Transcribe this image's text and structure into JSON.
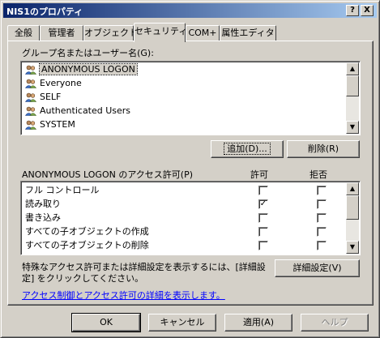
{
  "window": {
    "title": "NIS1のプロパティ",
    "help_glyph": "?",
    "close_glyph": "X"
  },
  "tabs": [
    {
      "label": "全般"
    },
    {
      "label": "管理者"
    },
    {
      "label": "オブジェクト"
    },
    {
      "label": "セキュリティ",
      "active": true
    },
    {
      "label": "COM+"
    },
    {
      "label": "属性エディタ"
    }
  ],
  "users_section": {
    "label": "グループ名またはユーザー名(G):",
    "items": [
      {
        "name": "ANONYMOUS LOGON",
        "selected": true
      },
      {
        "name": "Everyone"
      },
      {
        "name": "SELF"
      },
      {
        "name": "Authenticated Users"
      },
      {
        "name": "SYSTEM"
      }
    ],
    "add_button": "追加(D)...",
    "remove_button": "削除(R)"
  },
  "permissions_section": {
    "label": "ANONYMOUS LOGON のアクセス許可(P)",
    "allow_header": "許可",
    "deny_header": "拒否",
    "rows": [
      {
        "name": "フル コントロール",
        "allow": false,
        "deny": false
      },
      {
        "name": "読み取り",
        "allow": true,
        "deny": false
      },
      {
        "name": "書き込み",
        "allow": false,
        "deny": false
      },
      {
        "name": "すべての子オブジェクトの作成",
        "allow": false,
        "deny": false
      },
      {
        "name": "すべての子オブジェクトの削除",
        "allow": false,
        "deny": false
      }
    ],
    "check_glyph": "✓"
  },
  "advanced": {
    "text_line1": "特殊なアクセス許可または詳細設定を表示するには、[詳細設",
    "text_line2": "定] をクリックしてください。",
    "button": "詳細設定(V)"
  },
  "link": "アクセス制御とアクセス許可の詳細を表示します。",
  "footer": {
    "ok": "OK",
    "cancel": "キャンセル",
    "apply": "適用(A)",
    "help": "ヘルプ"
  }
}
